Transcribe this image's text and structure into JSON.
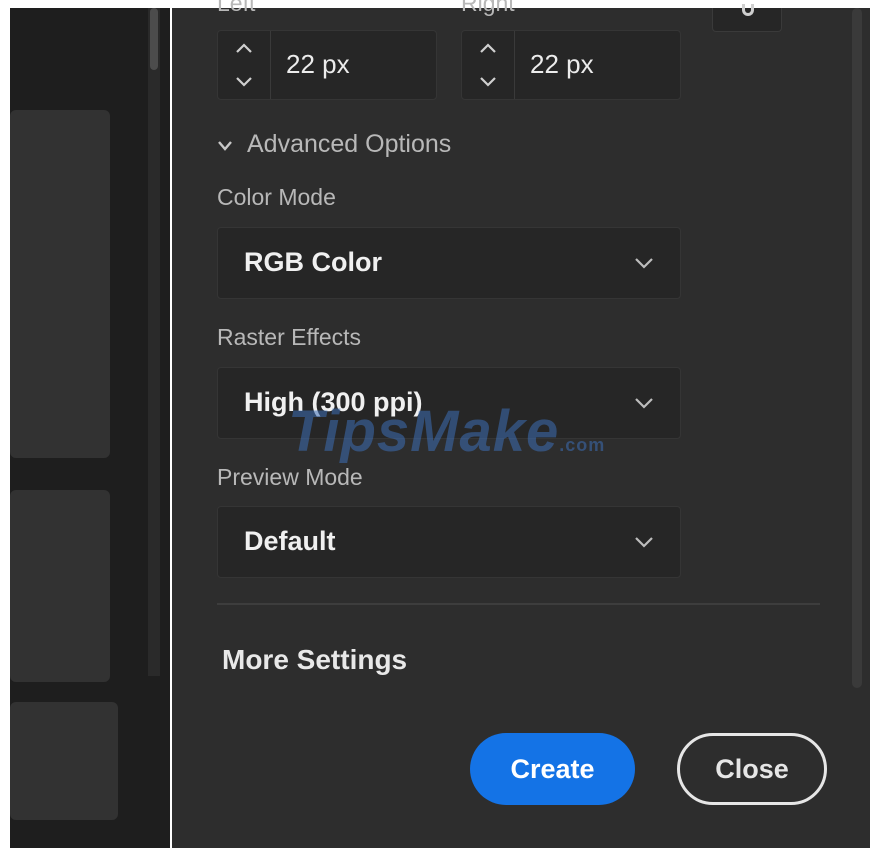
{
  "margins": {
    "left_label": "Left",
    "right_label": "Right",
    "left_value": "22 px",
    "right_value": "22 px"
  },
  "advanced": {
    "label": "Advanced Options",
    "expanded": true
  },
  "color_mode": {
    "label": "Color Mode",
    "value": "RGB Color"
  },
  "raster_effects": {
    "label": "Raster Effects",
    "value": "High (300 ppi)"
  },
  "preview_mode": {
    "label": "Preview Mode",
    "value": "Default"
  },
  "more_settings": "More Settings",
  "buttons": {
    "create": "Create",
    "close": "Close"
  },
  "watermark": {
    "text": "TipsMake",
    "suffix": ".com"
  },
  "colors": {
    "panel_bg": "#2d2d2d",
    "field_bg": "#262626",
    "accent": "#1473e6",
    "text": "#f0f0f0",
    "label_text": "#b8b8b8"
  },
  "icons": [
    "chevron-up-icon",
    "chevron-down-icon",
    "link-icon"
  ]
}
